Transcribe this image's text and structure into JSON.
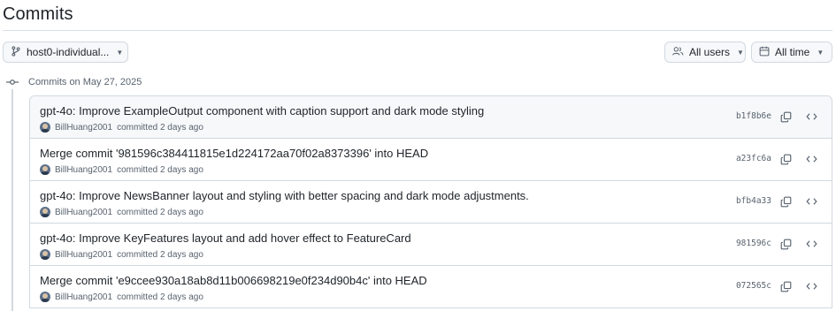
{
  "page": {
    "title": "Commits"
  },
  "toolbar": {
    "branch_label": "host0-individual...",
    "users_label": "All users",
    "time_label": "All time"
  },
  "group": {
    "label": "Commits on May 27, 2025"
  },
  "commits": [
    {
      "title": "gpt-4o: Improve ExampleOutput component with caption support and dark mode styling",
      "author": "BillHuang2001",
      "meta": "committed 2 days ago",
      "sha": "b1f8b6e"
    },
    {
      "title": "Merge commit '981596c384411815e1d224172aa70f02a8373396' into HEAD",
      "author": "BillHuang2001",
      "meta": "committed 2 days ago",
      "sha": "a23fc6a"
    },
    {
      "title": "gpt-4o: Improve NewsBanner layout and styling with better spacing and dark mode adjustments.",
      "author": "BillHuang2001",
      "meta": "committed 2 days ago",
      "sha": "bfb4a33"
    },
    {
      "title": "gpt-4o: Improve KeyFeatures layout and add hover effect to FeatureCard",
      "author": "BillHuang2001",
      "meta": "committed 2 days ago",
      "sha": "981596c"
    },
    {
      "title": "Merge commit 'e9ccee930a18ab8d11b006698219e0f234d90b4c' into HEAD",
      "author": "BillHuang2001",
      "meta": "committed 2 days ago",
      "sha": "072565c"
    }
  ],
  "icons": {
    "branch": "git-branch-icon",
    "users": "people-icon",
    "calendar": "calendar-icon",
    "commit": "git-commit-icon",
    "copy": "copy-icon",
    "browse": "code-icon"
  },
  "colors": {
    "text": "#1f2328",
    "muted": "#59636e",
    "border": "#d1d9e0",
    "row_highlight": "#f6f8fa"
  }
}
